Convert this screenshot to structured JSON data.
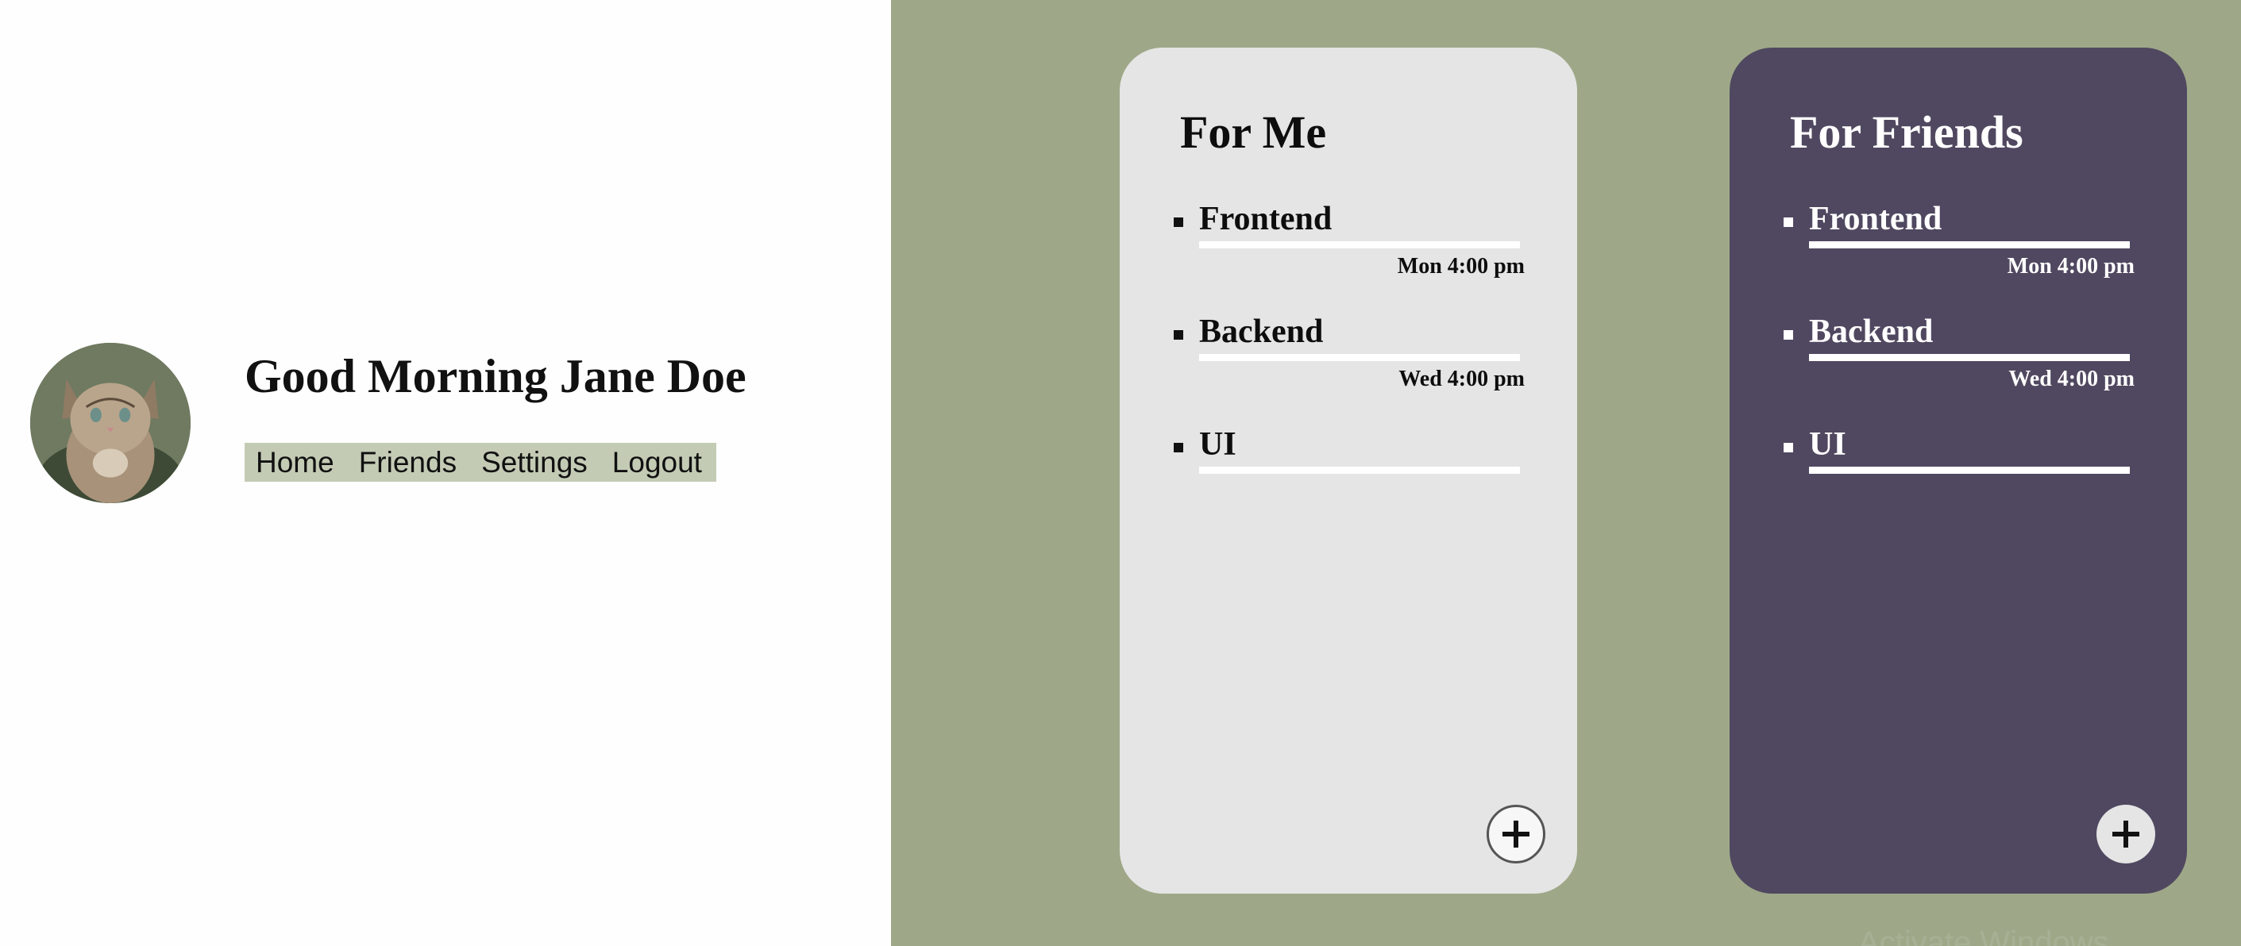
{
  "profile": {
    "greeting": "Good Morning Jane Doe",
    "avatar_alt": "kitten photo"
  },
  "nav": {
    "items": [
      {
        "label": "Home"
      },
      {
        "label": "Friends"
      },
      {
        "label": "Settings"
      },
      {
        "label": "Logout"
      }
    ]
  },
  "cards": {
    "me": {
      "title": "For Me",
      "tasks": [
        {
          "name": "Frontend",
          "time": "Mon 4:00 pm"
        },
        {
          "name": "Backend",
          "time": "Wed 4:00 pm"
        },
        {
          "name": "UI",
          "time": ""
        }
      ],
      "add_icon": "plus-icon"
    },
    "friends": {
      "title": "For Friends",
      "tasks": [
        {
          "name": "Frontend",
          "time": "Mon 4:00 pm"
        },
        {
          "name": "Backend",
          "time": "Wed 4:00 pm"
        },
        {
          "name": "UI",
          "time": ""
        }
      ],
      "add_icon": "plus-icon"
    }
  },
  "colors": {
    "board_background": "#9ea888",
    "me_card": "#e5e5e5",
    "friends_card": "#504860",
    "nav_background": "#c3cbb5"
  },
  "watermark": "Activate Windows"
}
